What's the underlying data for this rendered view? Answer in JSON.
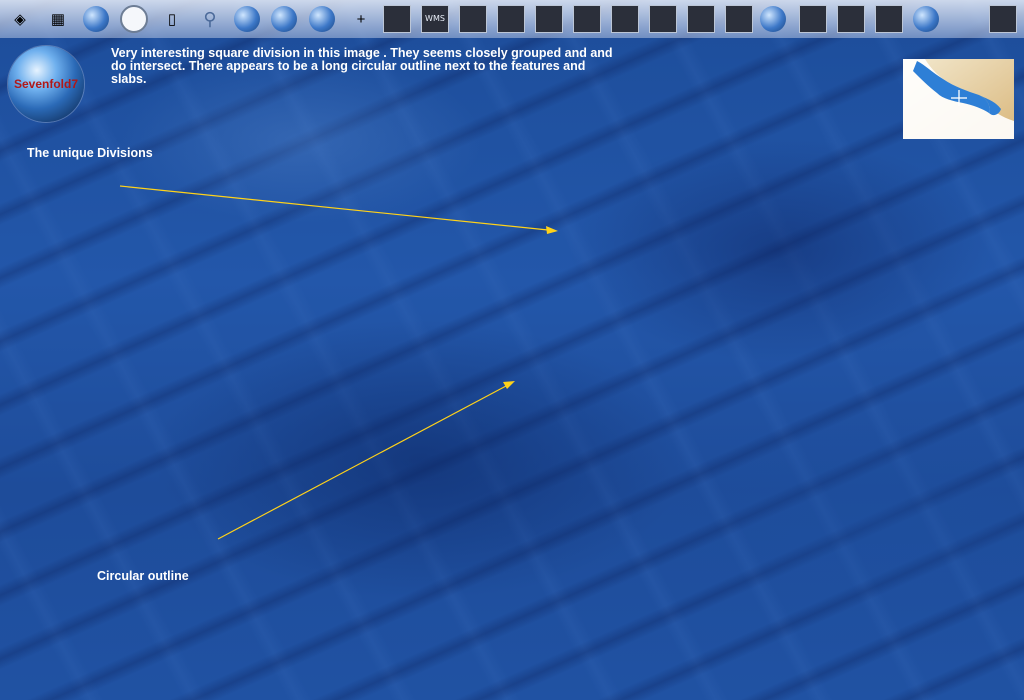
{
  "toolbar": {
    "items": [
      {
        "icon": "layers-icon",
        "glyph": "◈",
        "style": "plain"
      },
      {
        "icon": "grid-icon",
        "glyph": "▦",
        "style": "plain"
      },
      {
        "icon": "globe-grid-icon",
        "glyph": "",
        "style": "globe"
      },
      {
        "icon": "clock-icon",
        "glyph": "",
        "style": "clock"
      },
      {
        "icon": "document-icon",
        "glyph": "▯",
        "style": "plain"
      },
      {
        "icon": "search-icon",
        "glyph": "⚲",
        "style": "glass"
      },
      {
        "icon": "globe-icon",
        "glyph": "",
        "style": "globe"
      },
      {
        "icon": "earth-icon",
        "glyph": "",
        "style": "globe"
      },
      {
        "icon": "globe-pin-icon",
        "glyph": "",
        "style": "globe"
      },
      {
        "icon": "add-satellite-icon",
        "glyph": "+",
        "style": "plain"
      },
      {
        "icon": "layer-tile-icon",
        "glyph": "",
        "style": "tile"
      },
      {
        "icon": "wms-tile-icon",
        "glyph": "WMS",
        "style": "tile"
      },
      {
        "icon": "heatmap-tile-icon",
        "glyph": "",
        "style": "tile"
      },
      {
        "icon": "satellite-tile-1-icon",
        "glyph": "",
        "style": "tile"
      },
      {
        "icon": "satellite-tile-2-icon",
        "glyph": "",
        "style": "tile"
      },
      {
        "icon": "satellite-tile-3-icon",
        "glyph": "",
        "style": "tile"
      },
      {
        "icon": "satellite-tile-4-icon",
        "glyph": "",
        "style": "tile"
      },
      {
        "icon": "satellite-tile-5-icon",
        "glyph": "",
        "style": "tile"
      },
      {
        "icon": "satellite-tile-6-icon",
        "glyph": "",
        "style": "tile"
      },
      {
        "icon": "satellite-tile-7-icon",
        "glyph": "",
        "style": "tile"
      },
      {
        "icon": "blue-globe-icon",
        "glyph": "",
        "style": "globe"
      },
      {
        "icon": "map-tile-icon",
        "glyph": "",
        "style": "tile"
      },
      {
        "icon": "photo-collage-icon",
        "glyph": "",
        "style": "tile"
      },
      {
        "icon": "flags-icon",
        "glyph": "",
        "style": "tile"
      },
      {
        "icon": "landmarks-icon",
        "glyph": "",
        "style": "globe"
      },
      {
        "icon": "usa-map-icon",
        "glyph": "",
        "style": "plain"
      },
      {
        "icon": "settings-tile-icon",
        "glyph": "",
        "style": "tile"
      }
    ]
  },
  "logo": {
    "text": "Sevenfold7"
  },
  "annotations": {
    "description": "Very interesting square division in this image .  They seems closely grouped and and do intersect.  There appears to be a long circular outline next to the features and slabs.",
    "divisions_label": "The unique Divisions",
    "circular_label": "Circular outline"
  },
  "colors": {
    "arrow": "#ffd21a",
    "ocean": "#1f4f9e",
    "logo_text": "#b01818"
  }
}
